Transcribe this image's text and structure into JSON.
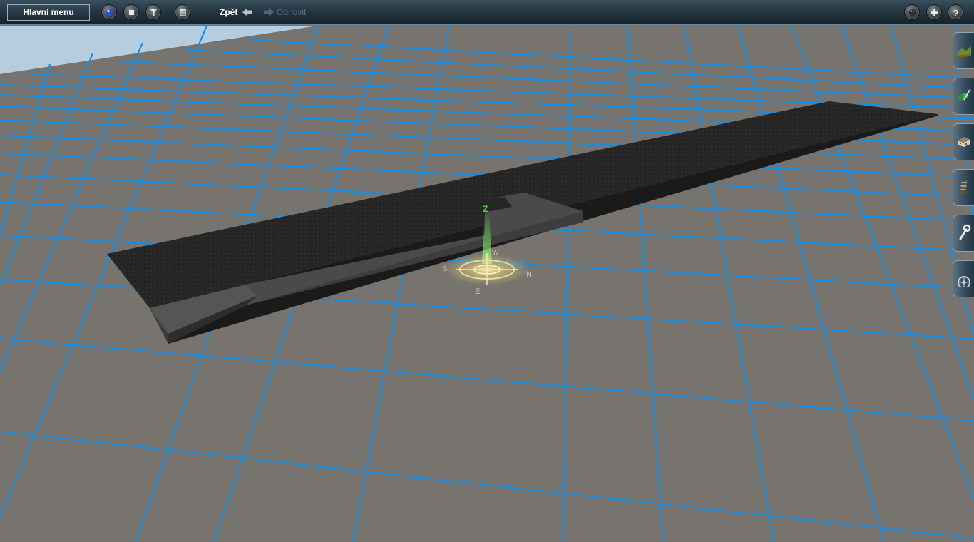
{
  "toolbar": {
    "main_menu_label": "Hlavní menu",
    "undo_label": "Zpět",
    "redo_label": "Obnovit"
  },
  "side_tools": [
    {
      "icon": "terrain-icon"
    },
    {
      "icon": "tree-paint-icon"
    },
    {
      "icon": "building-icon"
    },
    {
      "icon": "track-icon"
    },
    {
      "icon": "wrench-icon"
    },
    {
      "icon": "wheel-icon"
    }
  ],
  "viewport": {
    "compass": {
      "z": "Z",
      "n": "N",
      "s": "S",
      "e": "E",
      "w": "W"
    }
  },
  "colors": {
    "grid_line": "#1a8de0",
    "ground": "#77736e",
    "sky": "#b6cde0",
    "pad": "#262626",
    "gizmo_z": "#4cdc3c"
  }
}
